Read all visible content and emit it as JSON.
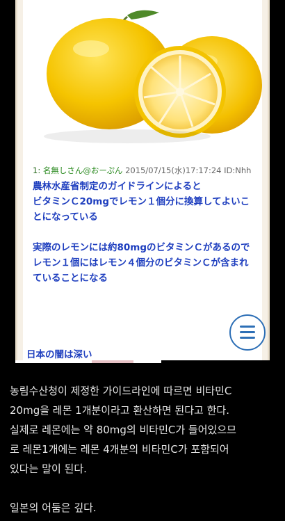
{
  "post": {
    "header": {
      "number": "1:",
      "name": "名無しさん@おーぷん",
      "meta": "2015/07/15(水)17:17:24 ID:Nhh"
    },
    "lines": [
      "農林水産省制定のガイドラインによると",
      "ビタミンＣ20mgでレモン１個分に換算してよいこ",
      "とになっている",
      "",
      "実際のレモンには約80mgのビタミンＣがあるので",
      "レモン１個にはレモン４個分のビタミンＣが含まれ",
      "ていることになる"
    ],
    "closing": "日本の闇は深い"
  },
  "menu_button": {
    "icon": "hamburger-menu-icon",
    "color": "#2d6fb6"
  },
  "caption": {
    "lines": [
      "농림수산청이 제정한 가이드라인에 따르면 비타민C",
      "20mg을 레몬 1개분이라고 환산하면 된다고 한다.",
      "실제로 레몬에는 약 80mg의 비타민C가 들어있으므",
      "로 레몬1개에는 레몬 4개분의 비타민C가 포함되어",
      "있다는 말이 된다."
    ],
    "closing": "일본의 어둠은 깊다."
  },
  "colors": {
    "post_text": "#1f3fbf",
    "name": "#2a8a1f",
    "background": "#000000",
    "lemon": "#f4c400"
  }
}
